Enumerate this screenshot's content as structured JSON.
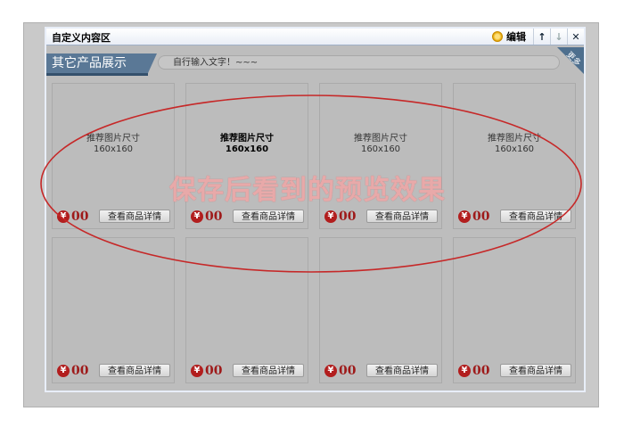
{
  "window": {
    "title": "自定义内容区",
    "edit_label": "编辑",
    "up_arrow": "↑",
    "down_arrow": "↓",
    "close": "✕"
  },
  "section": {
    "title": "其它产品展示",
    "custom_text": "自行输入文字！~~~",
    "more_label": "更多"
  },
  "products": [
    {
      "placeholder_line1": "推荐图片尺寸",
      "placeholder_line2": "160x160",
      "price": "00",
      "currency": "¥",
      "detail_button": "查看商品详情",
      "highlight": false
    },
    {
      "placeholder_line1": "推荐图片尺寸",
      "placeholder_line2": "160x160",
      "price": "00",
      "currency": "¥",
      "detail_button": "查看商品详情",
      "highlight": true
    },
    {
      "placeholder_line1": "推荐图片尺寸",
      "placeholder_line2": "160x160",
      "price": "00",
      "currency": "¥",
      "detail_button": "查看商品详情",
      "highlight": false
    },
    {
      "placeholder_line1": "推荐图片尺寸",
      "placeholder_line2": "160x160",
      "price": "00",
      "currency": "¥",
      "detail_button": "查看商品详情",
      "highlight": false
    },
    {
      "placeholder_line1": "",
      "placeholder_line2": "",
      "price": "00",
      "currency": "¥",
      "detail_button": "查看商品详情",
      "highlight": false
    },
    {
      "placeholder_line1": "",
      "placeholder_line2": "",
      "price": "00",
      "currency": "¥",
      "detail_button": "查看商品详情",
      "highlight": false
    },
    {
      "placeholder_line1": "",
      "placeholder_line2": "",
      "price": "00",
      "currency": "¥",
      "detail_button": "查看商品详情",
      "highlight": false
    },
    {
      "placeholder_line1": "",
      "placeholder_line2": "",
      "price": "00",
      "currency": "¥",
      "detail_button": "查看商品详情",
      "highlight": false
    }
  ],
  "annotation": {
    "text": "保存后看到的预览效果",
    "color": "#c62828"
  },
  "colors": {
    "section_bg": "#5a7896",
    "price": "#9e1a1a"
  }
}
